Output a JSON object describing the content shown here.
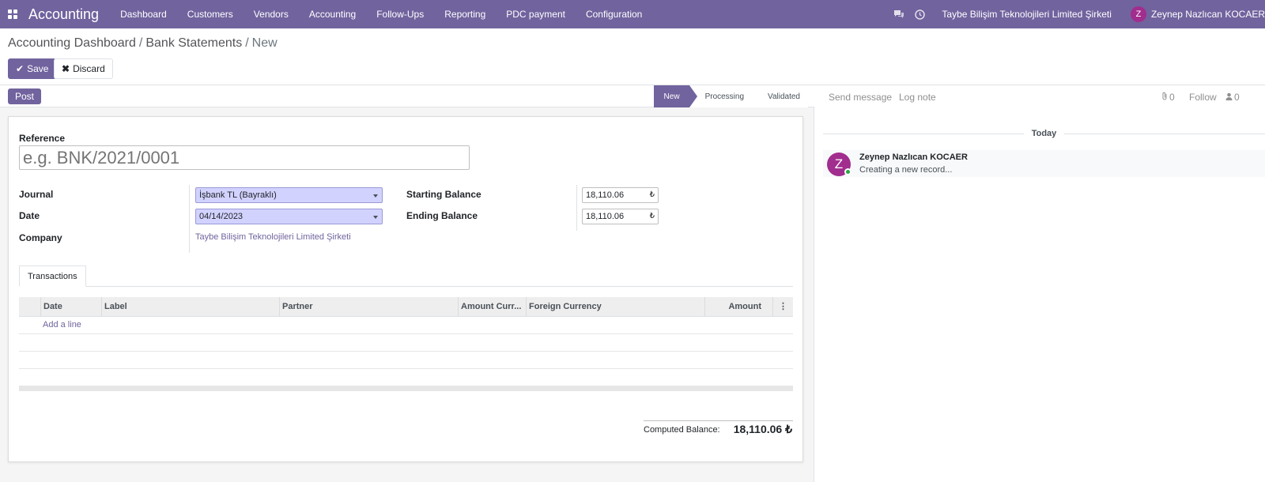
{
  "navbar": {
    "brand": "Accounting",
    "menu": [
      "Dashboard",
      "Customers",
      "Vendors",
      "Accounting",
      "Follow-Ups",
      "Reporting",
      "PDC payment",
      "Configuration"
    ],
    "company": "Taybe Bilişim Teknolojileri Limited Şirketi",
    "user_initial": "Z",
    "user_name": "Zeynep Nazlıcan KOCAER"
  },
  "breadcrumb": {
    "item1": "Accounting Dashboard",
    "item2": "Bank Statements",
    "current": "New",
    "sep": "/"
  },
  "buttons": {
    "save": "Save",
    "discard": "Discard",
    "post": "Post"
  },
  "statusbar": {
    "stages": [
      "New",
      "Processing",
      "Validated"
    ],
    "active": "New"
  },
  "form": {
    "reference_label": "Reference",
    "reference_placeholder": "e.g. BNK/2021/0001",
    "journal_label": "Journal",
    "journal_value": "İşbank TL (Bayraklı)",
    "date_label": "Date",
    "date_value": "04/14/2023",
    "company_label": "Company",
    "company_value": "Taybe Bilişim Teknolojileri Limited Şirketi",
    "starting_balance_label": "Starting Balance",
    "starting_balance_value": "18,110.06",
    "ending_balance_label": "Ending Balance",
    "ending_balance_value": "18,110.06",
    "currency_symbol": "₺"
  },
  "tabs": {
    "transactions": "Transactions"
  },
  "table": {
    "headers": [
      "Date",
      "Label",
      "Partner",
      "Amount Curr...",
      "Foreign Currency",
      "Amount"
    ],
    "add_line": "Add a line"
  },
  "totals": {
    "computed_label": "Computed Balance:",
    "computed_value": "18,110.06 ₺"
  },
  "chatter": {
    "send_message": "Send message",
    "log_note": "Log note",
    "attachments_count": "0",
    "follow": "Follow",
    "followers_count": "0",
    "today": "Today",
    "message_author": "Zeynep Nazlıcan KOCAER",
    "message_body": "Creating a new record...",
    "author_initial": "Z"
  },
  "colors": {
    "brand": "#71639e",
    "avatar": "#a12d8e",
    "required_field": "#d2d2ff"
  }
}
